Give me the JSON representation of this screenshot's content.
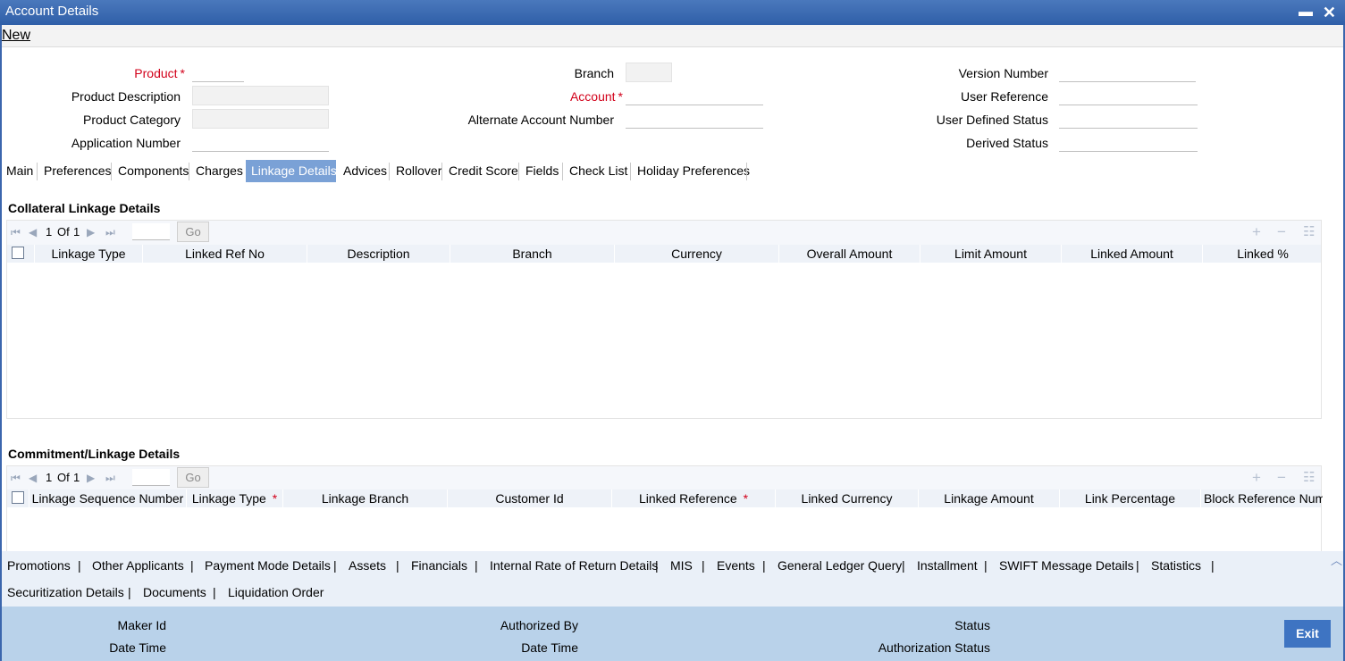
{
  "window": {
    "title": "Account Details",
    "minimize_glyph": "▬",
    "close_glyph": "✕"
  },
  "menu": {
    "new_label": "New"
  },
  "header_fields": {
    "product": {
      "label": "Product",
      "required": "*",
      "value": ""
    },
    "product_description": {
      "label": "Product Description",
      "value": ""
    },
    "product_category": {
      "label": "Product Category",
      "value": ""
    },
    "application_number": {
      "label": "Application Number",
      "value": ""
    },
    "branch": {
      "label": "Branch",
      "value": ""
    },
    "account": {
      "label": "Account",
      "required": "*",
      "value": ""
    },
    "alternate_account_number": {
      "label": "Alternate Account Number",
      "value": ""
    },
    "version_number": {
      "label": "Version Number",
      "value": ""
    },
    "user_reference": {
      "label": "User Reference",
      "value": ""
    },
    "user_defined_status": {
      "label": "User Defined Status",
      "value": ""
    },
    "derived_status": {
      "label": "Derived Status",
      "value": ""
    }
  },
  "tabs": [
    "Main",
    "Preferences",
    "Components",
    "Charges",
    "Linkage Details",
    "Advices",
    "Rollover",
    "Credit Score",
    "Fields",
    "Check List",
    "Holiday Preferences"
  ],
  "active_tab": "Linkage Details",
  "collateral": {
    "title": "Collateral Linkage Details",
    "pager": {
      "current": "1",
      "of_label": "Of",
      "total": "1",
      "go_label": "Go"
    },
    "columns": [
      "Linkage Type",
      "Linked Ref No",
      "Description",
      "Branch",
      "Currency",
      "Overall Amount",
      "Limit Amount",
      "Linked Amount",
      "Linked %"
    ],
    "rows": []
  },
  "commitment": {
    "title": "Commitment/Linkage Details",
    "pager": {
      "current": "1",
      "of_label": "Of",
      "total": "1",
      "go_label": "Go"
    },
    "columns": [
      "Linkage Sequence Number",
      "Linkage Type",
      "Linkage Branch",
      "Customer Id",
      "Linked Reference",
      "Linked Currency",
      "Linkage Amount",
      "Link Percentage",
      "Block Reference Numb"
    ],
    "required_mark": "*",
    "rows": []
  },
  "icons": {
    "first": "first-page-icon",
    "prev": "prev-page-icon",
    "next": "next-page-icon",
    "last": "last-page-icon",
    "add": "add-row-icon",
    "delete": "delete-row-icon",
    "view": "single-view-icon",
    "collapse": "collapse-icon"
  },
  "links_row1": [
    "Promotions",
    "Other Applicants",
    "Payment Mode Details",
    "Assets",
    "Financials",
    "Internal Rate of Return Details",
    "MIS",
    "Events",
    "General Ledger Query",
    "Installment",
    "SWIFT Message Details",
    "Statistics"
  ],
  "links_row2": [
    "Securitization Details",
    "Documents",
    "Liquidation Order"
  ],
  "link_separator": "|",
  "footer": {
    "maker_id": "Maker Id",
    "maker_date_time": "Date Time",
    "authorized_by": "Authorized By",
    "checker_date_time": "Date Time",
    "status": "Status",
    "authorization_status": "Authorization Status",
    "exit_label": "Exit"
  },
  "colors": {
    "titlebar": "#2f5fa8",
    "active_tab": "#7aa1d6",
    "required": "#d2001a",
    "footer": "#b9d2ea",
    "exit_button": "#3e74c2"
  }
}
